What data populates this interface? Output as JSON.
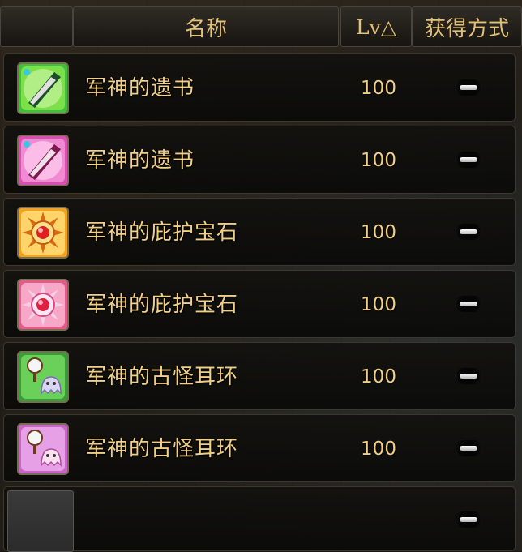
{
  "header": {
    "name_label": "名称",
    "level_label": "Lv△",
    "obtain_label": "获得方式"
  },
  "items": [
    {
      "name": "军神的遗书",
      "level": "100",
      "icon": "quill-pen-icon",
      "frame_color": "#3fbf3a"
    },
    {
      "name": "军神的遗书",
      "level": "100",
      "icon": "quill-pen-icon",
      "frame_color": "#d94fb2"
    },
    {
      "name": "军神的庇护宝石",
      "level": "100",
      "icon": "sun-gem-icon",
      "frame_color": "#f2a21c"
    },
    {
      "name": "军神的庇护宝石",
      "level": "100",
      "icon": "sun-gem-icon",
      "frame_color": "#e05c8c"
    },
    {
      "name": "军神的古怪耳环",
      "level": "100",
      "icon": "ghost-earring-icon",
      "frame_color": "#3a9d3a"
    },
    {
      "name": "军神的古怪耳环",
      "level": "100",
      "icon": "ghost-earring-icon",
      "frame_color": "#c865c8"
    },
    {
      "name": "",
      "level": "",
      "icon": "empty-slot",
      "frame_color": "#3a3a3a"
    }
  ],
  "obtain_symbol": "minus-icon"
}
